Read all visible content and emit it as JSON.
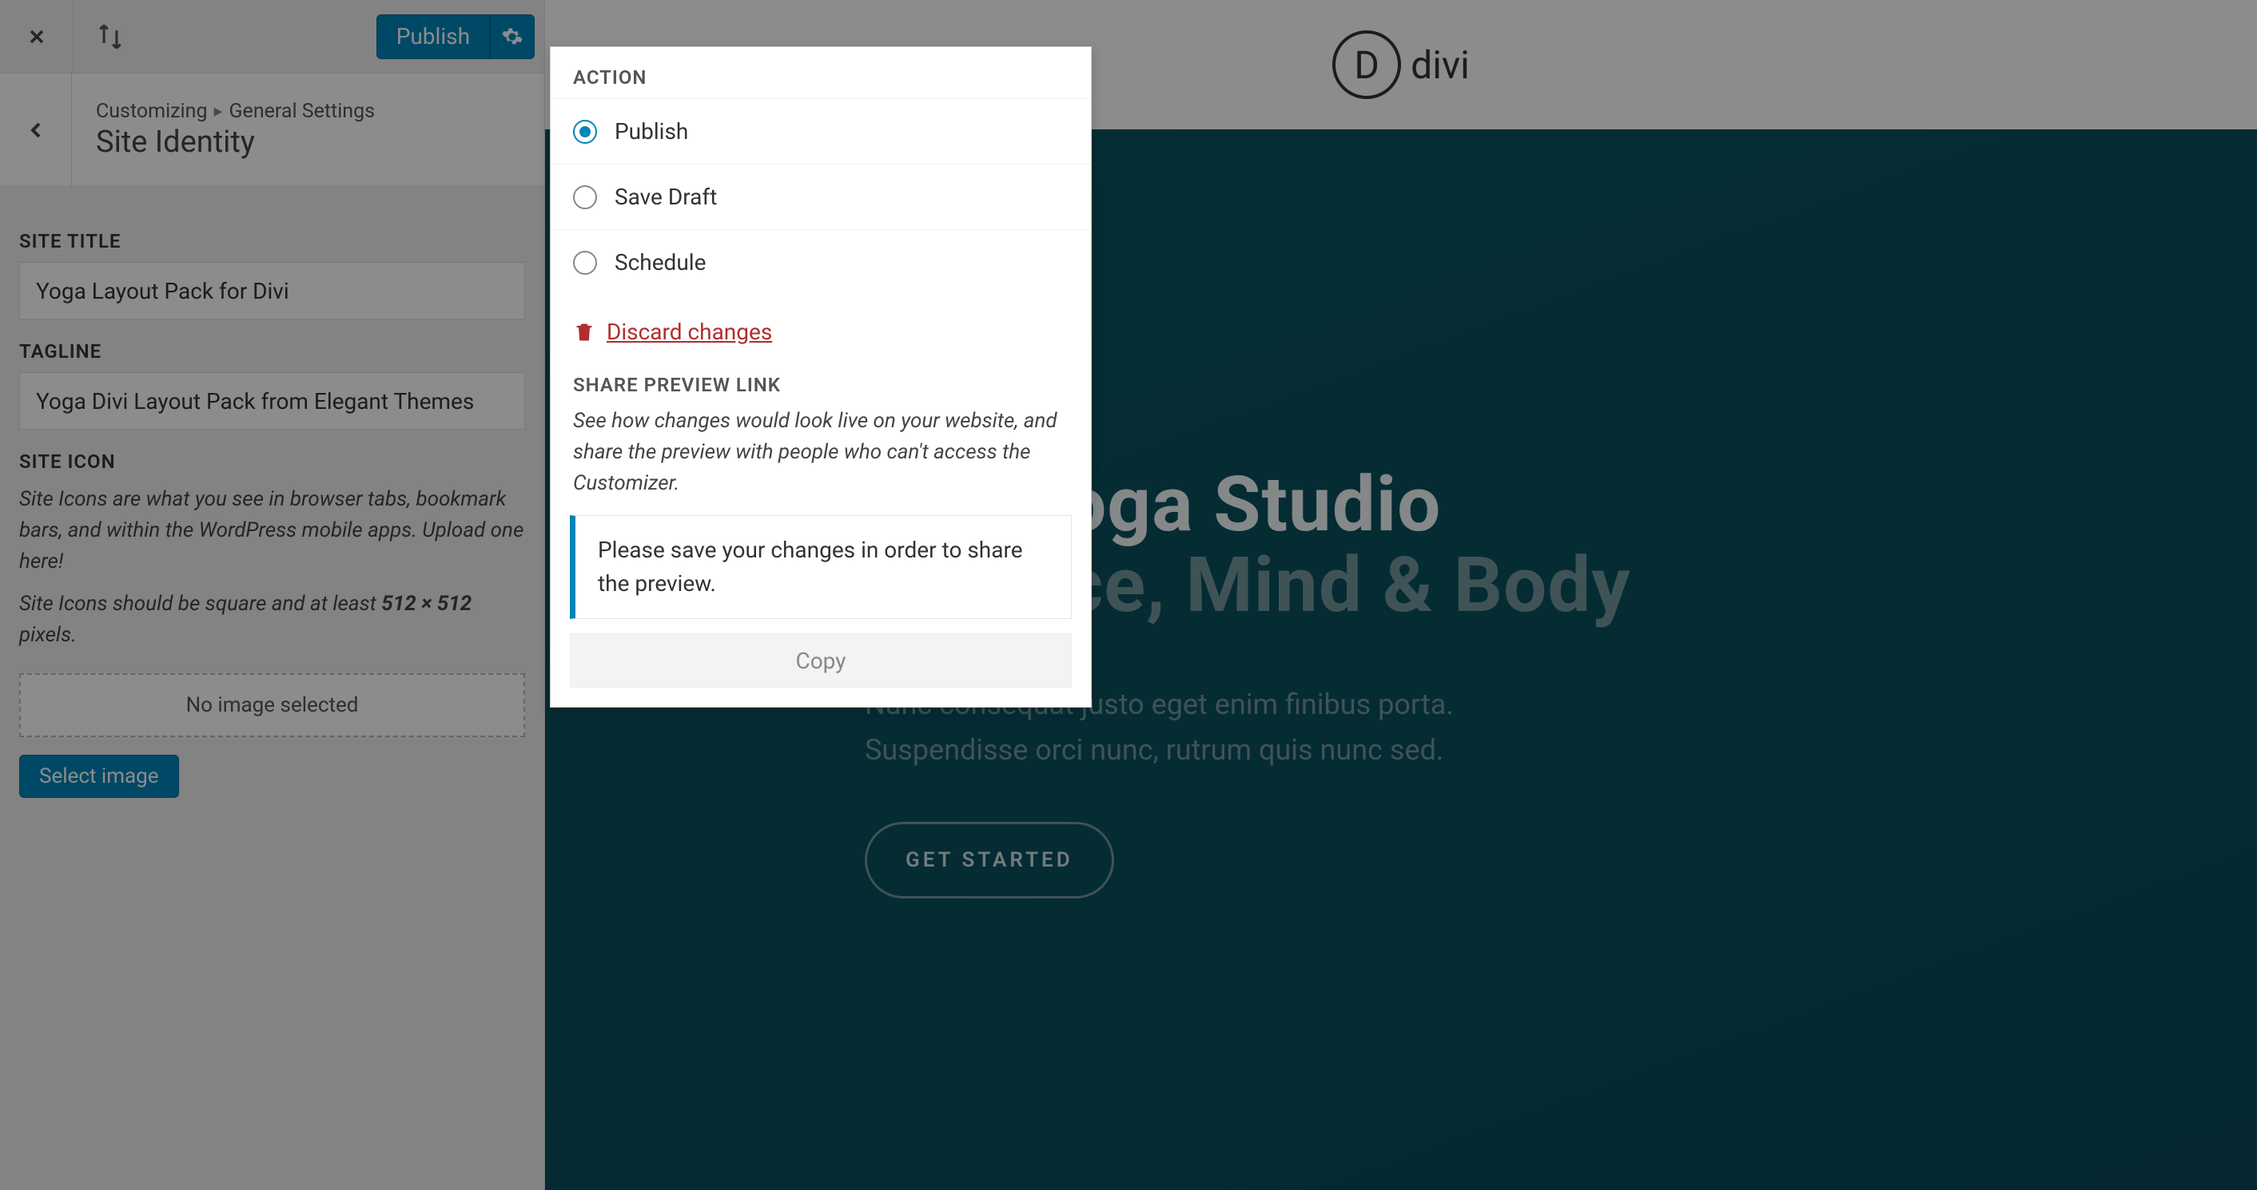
{
  "topbar": {
    "publish_label": "Publish"
  },
  "header": {
    "breadcrumb_root": "Customizing",
    "breadcrumb_leaf": "General Settings",
    "title": "Site Identity"
  },
  "fields": {
    "site_title_label": "SITE TITLE",
    "site_title_value": "Yoga Layout Pack for Divi",
    "tagline_label": "TAGLINE",
    "tagline_value": "Yoga Divi Layout Pack from Elegant Themes",
    "site_icon_label": "SITE ICON",
    "site_icon_help1": "Site Icons are what you see in browser tabs, bookmark bars, and within the WordPress mobile apps. Upload one here!",
    "site_icon_help2_pre": "Site Icons should be square and at least ",
    "site_icon_help2_strong": "512 × 512",
    "site_icon_help2_post": " pixels.",
    "no_image": "No image selected",
    "select_image": "Select image"
  },
  "popover": {
    "action_label": "ACTION",
    "options": {
      "publish": "Publish",
      "save_draft": "Save Draft",
      "schedule": "Schedule",
      "selected": "publish"
    },
    "discard": "Discard changes",
    "share_label": "SHARE PREVIEW LINK",
    "share_desc": "See how changes would look live on your website, and share the preview with people who can't access the Customizer.",
    "share_notice": "Please save your changes in order to share the preview.",
    "copy": "Copy"
  },
  "preview": {
    "logo_text": "divi",
    "logo_letter": "D",
    "hero_line1": "Divi Yoga Studio",
    "hero_line2": "Balance, Mind & Body",
    "sub_line1": "Nunc consequat justo eget enim finibus porta.",
    "sub_line2": "Suspendisse orci nunc, rutrum quis nunc sed.",
    "cta": "GET STARTED"
  }
}
